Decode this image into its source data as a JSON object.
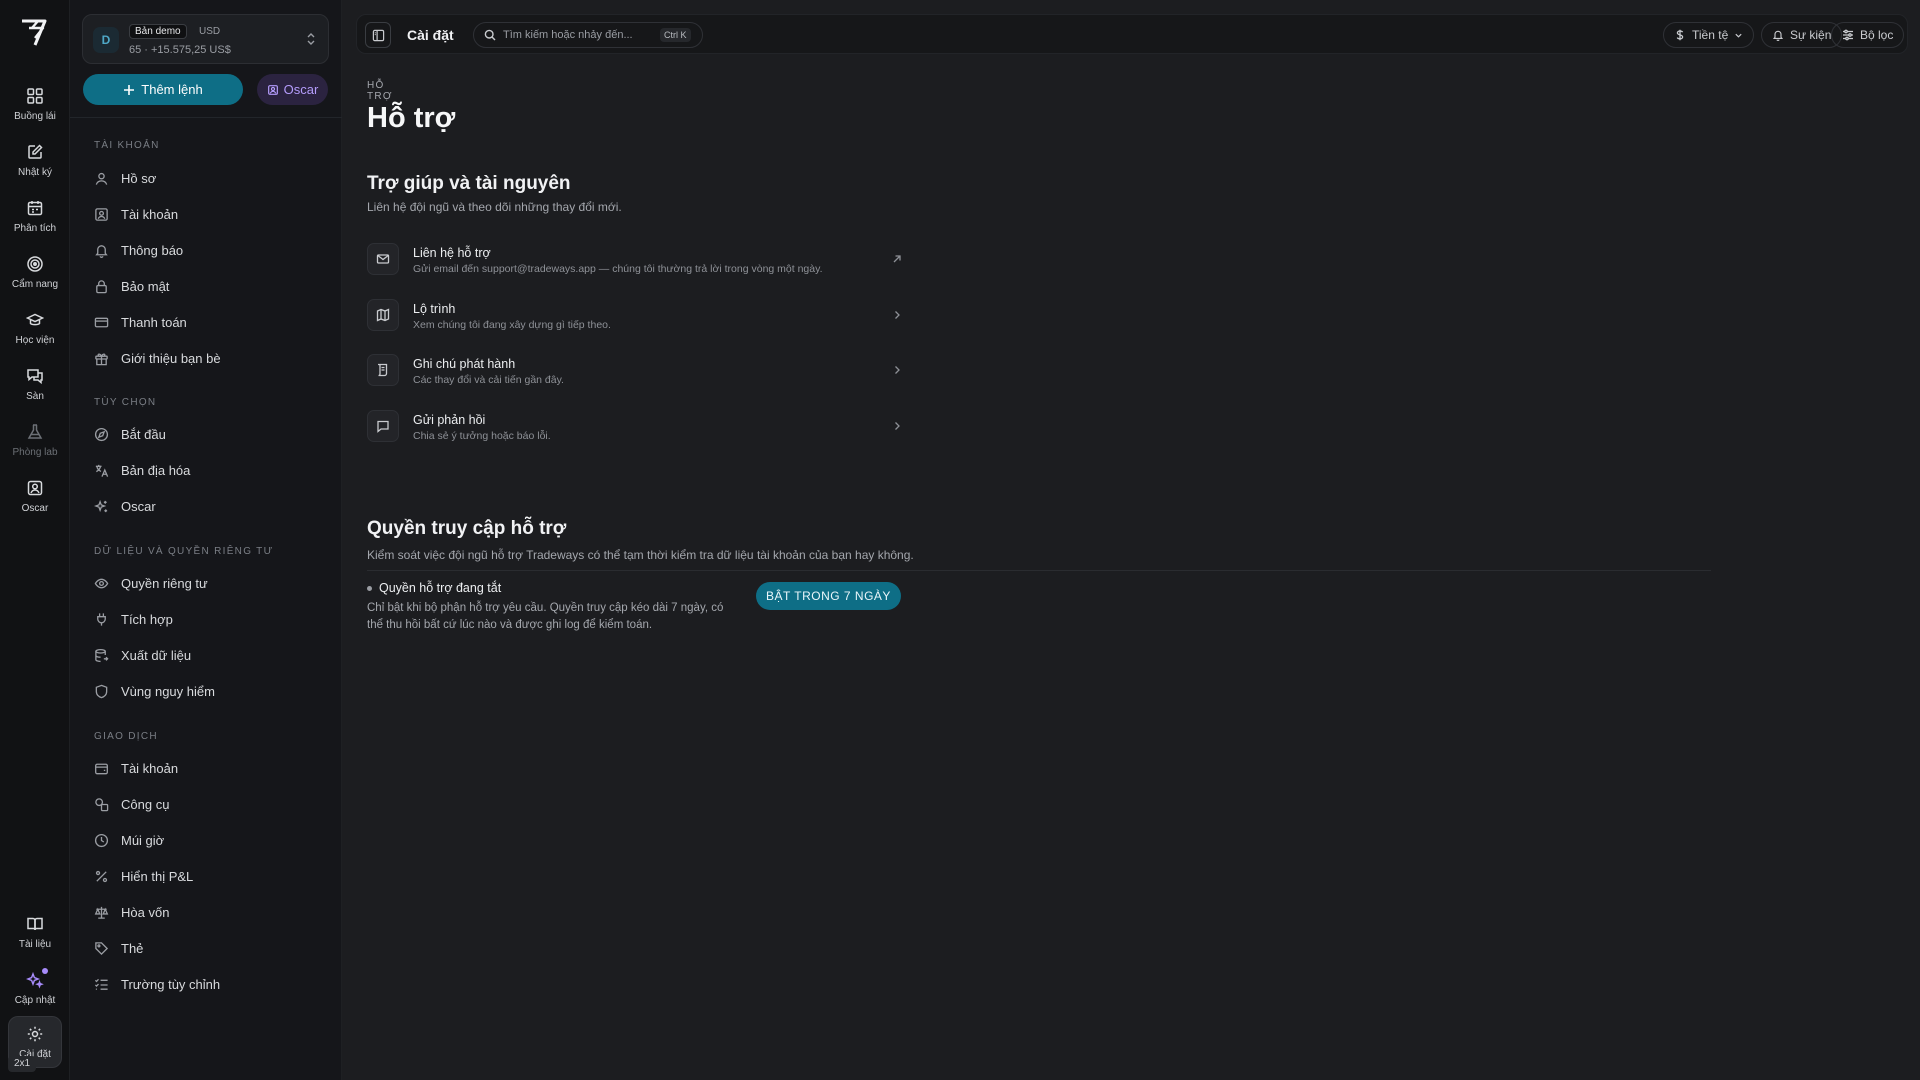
{
  "rail": {
    "items": [
      {
        "label": "Buồng lái",
        "icon": "grid-icon"
      },
      {
        "label": "Nhật ký",
        "icon": "edit-icon"
      },
      {
        "label": "Phân tích",
        "icon": "calendar-icon"
      },
      {
        "label": "Cẩm nang",
        "icon": "target-icon"
      },
      {
        "label": "Học viện",
        "icon": "graduation-cap-icon"
      },
      {
        "label": "Sàn",
        "icon": "chat-icon"
      },
      {
        "label": "Phòng lab",
        "icon": "flask-icon"
      },
      {
        "label": "Oscar",
        "icon": "contact-icon"
      }
    ],
    "bottom": [
      {
        "label": "Tài liệu",
        "icon": "book-icon"
      },
      {
        "label": "Cập nhật",
        "icon": "sparkles-icon"
      },
      {
        "label": "Cài đặt",
        "icon": "gear-icon"
      }
    ],
    "badge": "2x1"
  },
  "account": {
    "avatar": "D",
    "mode": "Bản demo",
    "currency": "USD",
    "balance": "65 · +15.575,25 US$"
  },
  "actions": {
    "add_label": "Thêm lệnh",
    "oscar_label": "Oscar"
  },
  "sidebar": {
    "sections": [
      {
        "title": "TÀI KHOẢN",
        "items": [
          "Hồ sơ",
          "Tài khoản",
          "Thông báo",
          "Bảo mật",
          "Thanh toán",
          "Giới thiệu bạn bè"
        ]
      },
      {
        "title": "TÙY CHỌN",
        "items": [
          "Bắt đầu",
          "Bản địa hóa",
          "Oscar"
        ]
      },
      {
        "title": "DỮ LIỆU VÀ QUYỀN RIÊNG TƯ",
        "items": [
          "Quyền riêng tư",
          "Tích hợp",
          "Xuất dữ liệu",
          "Vùng nguy hiểm"
        ]
      },
      {
        "title": "GIAO DỊCH",
        "items": [
          "Tài khoản",
          "Công cụ",
          "Múi giờ",
          "Hiển thị P&L",
          "Hòa vốn",
          "Thẻ",
          "Trường tùy chỉnh"
        ]
      }
    ]
  },
  "topbar": {
    "title": "Cài đặt",
    "search_placeholder": "Tìm kiếm hoặc nhảy đến...",
    "shortcut": "Ctrl K",
    "currency_label": "Tiền tệ",
    "events_label": "Sự kiện",
    "filter_label": "Bộ lọc"
  },
  "page": {
    "eyebrow": "HỖ TRỢ",
    "title": "Hỗ trợ",
    "resources": {
      "title": "Trợ giúp và tài nguyên",
      "subtitle": "Liên hệ đội ngũ và theo dõi những thay đổi mới.",
      "rows": [
        {
          "title": "Liên hệ hỗ trợ",
          "desc": "Gửi email đến support@tradeways.app — chúng tôi thường trả lời trong vòng một ngày.",
          "icon": "mail-icon",
          "arrow": "external-link-icon"
        },
        {
          "title": "Lộ trình",
          "desc": "Xem chúng tôi đang xây dựng gì tiếp theo.",
          "icon": "map-icon",
          "arrow": "chevron-right-icon"
        },
        {
          "title": "Ghi chú phát hành",
          "desc": "Các thay đổi và cải tiến gần đây.",
          "icon": "scroll-icon",
          "arrow": "chevron-right-icon"
        },
        {
          "title": "Gửi phản hồi",
          "desc": "Chia sẻ ý tưởng hoặc báo lỗi.",
          "icon": "message-icon",
          "arrow": "chevron-right-icon"
        }
      ]
    },
    "access": {
      "title": "Quyền truy cập hỗ trợ",
      "subtitle": "Kiểm soát việc đội ngũ hỗ trợ Tradeways có thể tạm thời kiểm tra dữ liệu tài khoản của bạn hay không.",
      "status": "Quyền hỗ trợ đang tắt",
      "desc": "Chỉ bật khi bộ phận hỗ trợ yêu cầu. Quyền truy cập kéo dài 7 ngày, có thể thu hồi bất cứ lúc nào và được ghi log để kiểm toán.",
      "button": "BẬT TRONG 7 NGÀY"
    }
  },
  "colors": {
    "accent": "#0e6e86",
    "oscar": "#b49cfb",
    "background": "#1c1d20"
  }
}
